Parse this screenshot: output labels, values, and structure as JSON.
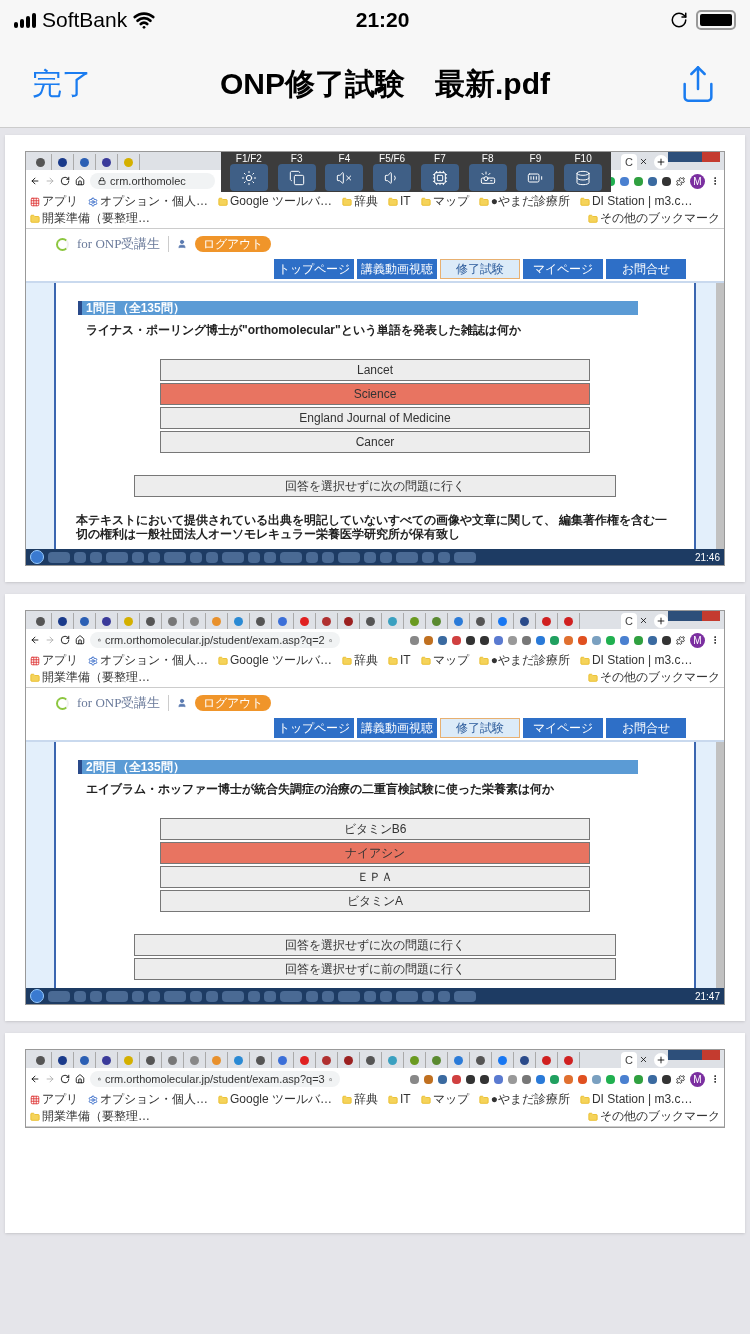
{
  "status_bar": {
    "carrier": "SoftBank",
    "time": "21:20"
  },
  "nav": {
    "done": "完了",
    "title": "ONP修了試験　最新.pdf"
  },
  "pages": [
    {
      "fkey_overlay": [
        "F1/F2",
        "F3",
        "F4",
        "F5/F6",
        "F7",
        "F8",
        "F9",
        "F10"
      ],
      "active_tab": "C",
      "url": "crm.orthomolec",
      "avatar": "M",
      "bookmarks": [
        "アプリ",
        "オプション・個人…",
        "Google ツールバ…",
        "辞典",
        "IT",
        "マップ",
        "●やまだ診療所",
        "DI Station | m3.c…",
        "開業準備（要整理…",
        "その他のブックマーク"
      ],
      "site": {
        "logo": "for ONP受講生",
        "logout": "ログアウト",
        "menu": [
          {
            "label": "トップページ",
            "selected": false
          },
          {
            "label": "講義動画視聴",
            "selected": false
          },
          {
            "label": "修了試験",
            "selected": true
          },
          {
            "label": "マイページ",
            "selected": false
          },
          {
            "label": "お問合せ",
            "selected": false
          }
        ]
      },
      "question": {
        "header": "1問目（全135問）",
        "text": "ライナス・ポーリング博士が\"orthomolecular\"という単語を発表した雑誌は何か",
        "options": [
          {
            "label": "Lancet",
            "selected": false
          },
          {
            "label": "Science",
            "selected": true
          },
          {
            "label": "England Journal of Medicine",
            "selected": false
          },
          {
            "label": "Cancer",
            "selected": false
          }
        ],
        "actions": [
          "回答を選択せずに次の問題に行く"
        ],
        "footer": "本テキストにおいて提供されている出典を明記していないすべての画像や文章に関して、 編集著作権を含む一切の権利は一般社団法人オーソモレキュラー栄養医学研究所が保有致し"
      },
      "taskbar_time": "21:46"
    },
    {
      "active_tab": "C",
      "url": "crm.orthomolecular.jp/student/exam.asp?q=2",
      "avatar": "M",
      "bookmarks": [
        "アプリ",
        "オプション・個人…",
        "Google ツールバ…",
        "辞典",
        "IT",
        "マップ",
        "●やまだ診療所",
        "DI Station | m3.c…",
        "開業準備（要整理…",
        "その他のブックマーク"
      ],
      "site": {
        "logo": "for ONP受講生",
        "logout": "ログアウト",
        "menu": [
          {
            "label": "トップページ",
            "selected": false
          },
          {
            "label": "講義動画視聴",
            "selected": false
          },
          {
            "label": "修了試験",
            "selected": true
          },
          {
            "label": "マイページ",
            "selected": false
          },
          {
            "label": "お問合せ",
            "selected": false
          }
        ]
      },
      "question": {
        "header": "2問目（全135問）",
        "text": "エイブラム・ホッファー博士が統合失調症の治療の二重盲検試験に使った栄養素は何か",
        "options": [
          {
            "label": "ビタミンB6",
            "selected": false
          },
          {
            "label": "ナイアシン",
            "selected": true
          },
          {
            "label": "ＥＰＡ",
            "selected": false
          },
          {
            "label": "ビタミンA",
            "selected": false
          }
        ],
        "actions": [
          "回答を選択せずに次の問題に行く",
          "回答を選択せずに前の問題に行く"
        ]
      },
      "taskbar_time": "21:47"
    },
    {
      "active_tab": "C",
      "url": "crm.orthomolecular.jp/student/exam.asp?q=3",
      "avatar": "M",
      "bookmarks": [
        "アプリ",
        "オプション・個人…",
        "Google ツールバ…",
        "辞典",
        "IT",
        "マップ",
        "●やまだ診療所",
        "DI Station | m3.c…",
        "開業準備（要整理…",
        "その他のブックマーク"
      ]
    }
  ]
}
